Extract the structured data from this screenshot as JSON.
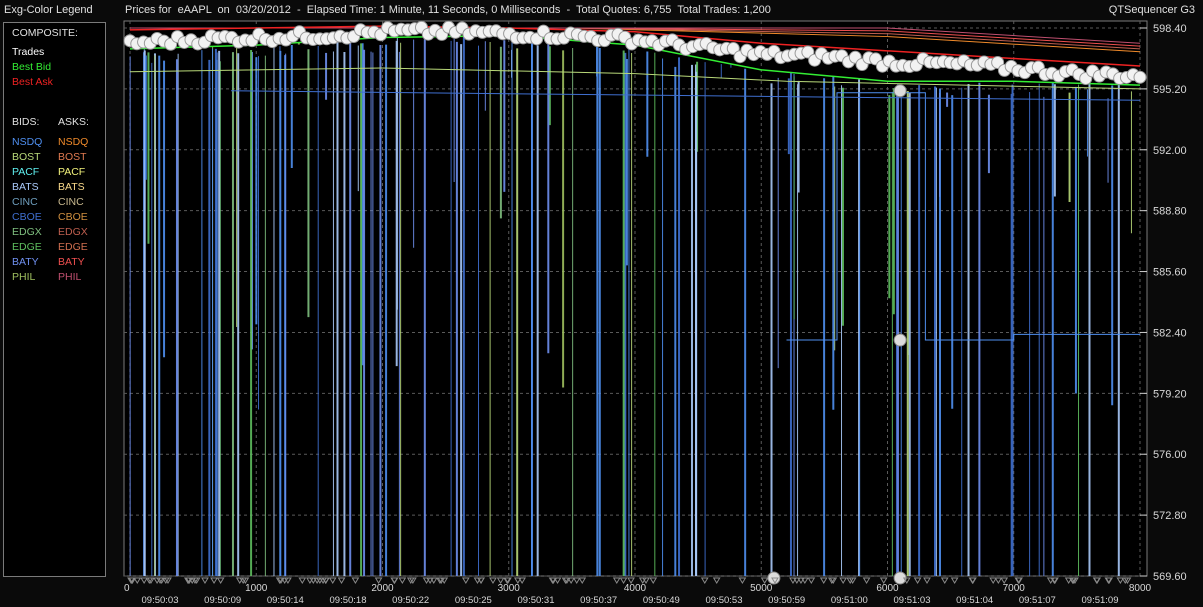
{
  "header": {
    "legend_title": "Exg-Color Legend",
    "chart_title": "Prices for  eAAPL  on  03/20/2012  -  Elapsed Time: 1 Minute, 11 Seconds, 0 Milliseconds  -  Total Quotes: 6,755  Total Trades: 1,200",
    "app_name": "QTSequencer G3"
  },
  "legend": {
    "composite_label": "COMPOSITE:",
    "composite": [
      {
        "label": "Trades",
        "color": "#ffffff"
      },
      {
        "label": "Best Bid",
        "color": "#33ee33"
      },
      {
        "label": "Best Ask",
        "color": "#ee2222"
      }
    ],
    "bids_label": "BIDS:",
    "asks_label": "ASKS:",
    "exchanges": [
      {
        "bid": "NSDQ",
        "bid_color": "#4f8ff0",
        "ask": "NSDQ",
        "ask_color": "#f08a2a"
      },
      {
        "bid": "BOST",
        "bid_color": "#b9d979",
        "ask": "BOST",
        "ask_color": "#e07a50"
      },
      {
        "bid": "PACF",
        "bid_color": "#5ff0f0",
        "ask": "PACF",
        "ask_color": "#f0f07a"
      },
      {
        "bid": "BATS",
        "bid_color": "#a9c9f9",
        "ask": "BATS",
        "ask_color": "#f9d98a"
      },
      {
        "bid": "CINC",
        "bid_color": "#6f9fbf",
        "ask": "CINC",
        "ask_color": "#c9b98f"
      },
      {
        "bid": "CBOE",
        "bid_color": "#3f6fd0",
        "ask": "CBOE",
        "ask_color": "#d08f3f"
      },
      {
        "bid": "EDGX",
        "bid_color": "#7fbf7f",
        "ask": "EDGX",
        "ask_color": "#bf5f4f"
      },
      {
        "bid": "EDGE",
        "bid_color": "#5fbf5f",
        "ask": "EDGE",
        "ask_color": "#d06f4f"
      },
      {
        "bid": "BATY",
        "bid_color": "#6f8fef",
        "ask": "BATY",
        "ask_color": "#ef4f4f"
      },
      {
        "bid": "PHIL",
        "bid_color": "#9fbf5f",
        "ask": "PHIL",
        "ask_color": "#bf4f6f"
      }
    ]
  },
  "chart_data": {
    "type": "line",
    "xlim": [
      0,
      8000
    ],
    "ylim": [
      569.6,
      598.4
    ],
    "y_ticks": [
      "598.40",
      "595.20",
      "592.00",
      "588.80",
      "585.60",
      "582.40",
      "579.20",
      "576.00",
      "572.80",
      "569.60"
    ],
    "x_ticks": [
      "0",
      "1000",
      "2000",
      "3000",
      "4000",
      "5000",
      "6000",
      "7000",
      "8000"
    ],
    "time_labels": [
      "09:50:03",
      "09:50:09",
      "09:50:14",
      "09:50:18",
      "09:50:22",
      "09:50:25",
      "09:50:31",
      "09:50:37",
      "09:50:49",
      "09:50:53",
      "09:50:59",
      "09:51:00",
      "09:51:03",
      "09:51:04",
      "09:51:07",
      "09:51:09"
    ],
    "grid": true,
    "series": [
      {
        "name": "Trades",
        "color": "#ffffff",
        "x": [
          0,
          500,
          1000,
          1500,
          2000,
          2500,
          3000,
          3500,
          4000,
          4500,
          5000,
          5500,
          6000,
          6500,
          7000,
          7500,
          8000
        ],
        "y": [
          597.6,
          597.8,
          597.9,
          598.0,
          598.2,
          598.2,
          598.1,
          598.0,
          597.8,
          597.4,
          597.0,
          596.9,
          596.6,
          596.5,
          596.3,
          596.0,
          595.9
        ]
      },
      {
        "name": "Best Ask",
        "color": "#ee2222",
        "x": [
          0,
          1000,
          2000,
          3000,
          4000,
          5000,
          6000,
          7000,
          8000
        ],
        "y": [
          598.3,
          598.4,
          598.5,
          598.4,
          598.2,
          597.6,
          597.2,
          596.8,
          596.4
        ]
      },
      {
        "name": "Best Bid",
        "color": "#33ee33",
        "x": [
          0,
          1000,
          2000,
          3000,
          4000,
          5000,
          6000,
          7000,
          8000
        ],
        "y": [
          597.3,
          597.5,
          597.9,
          598.0,
          597.5,
          596.2,
          595.6,
          595.6,
          595.4
        ]
      }
    ],
    "isolated_trades": [
      {
        "x": 6100,
        "y": 595.1
      },
      {
        "x": 6100,
        "y": 582.0
      },
      {
        "x": 5100,
        "y": 569.6
      },
      {
        "x": 6100,
        "y": 569.6
      }
    ]
  }
}
